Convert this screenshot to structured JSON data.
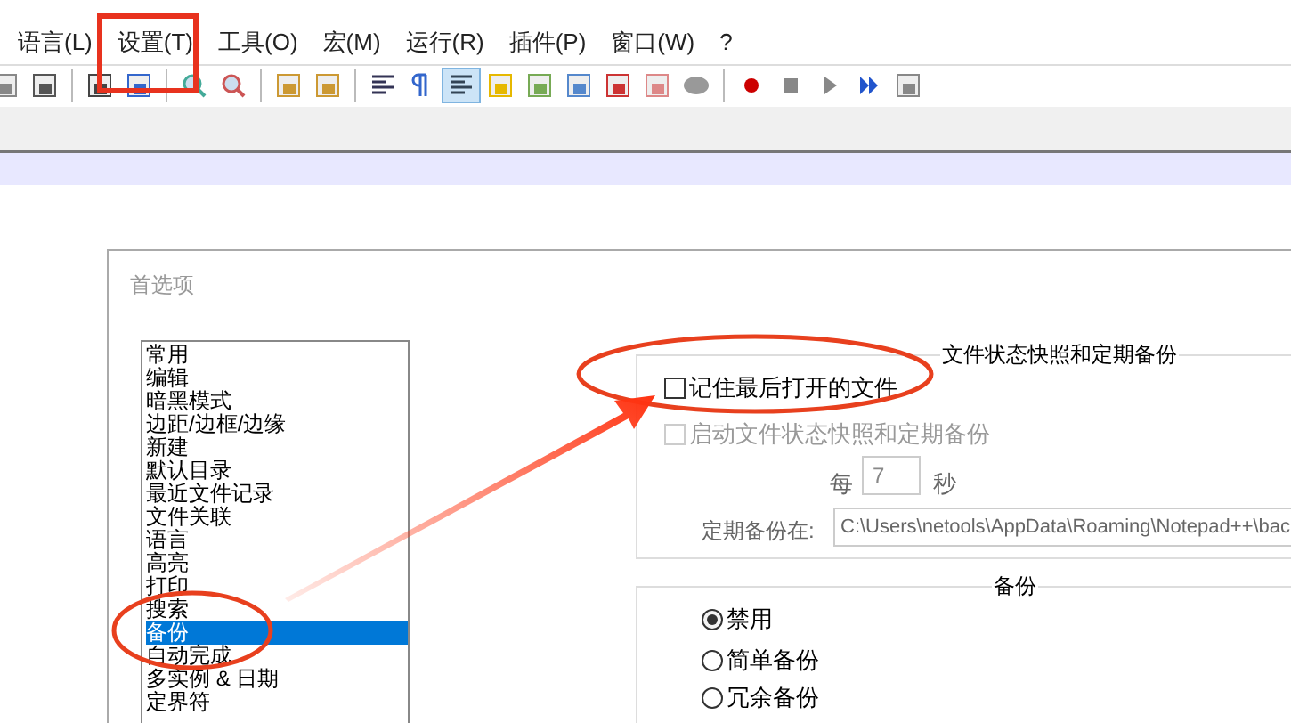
{
  "menu": [
    "语言(L)",
    "设置(T)",
    "工具(O)",
    "宏(M)",
    "运行(R)",
    "插件(P)",
    "窗口(W)",
    "?"
  ],
  "toolbar_buttons": [
    {
      "selected": false
    },
    {
      "selected": false
    },
    {
      "selected": false
    },
    {
      "selected": false
    },
    {
      "selected": false
    },
    {
      "selected": false
    },
    {
      "selected": false
    },
    {
      "selected": false
    },
    {
      "selected": false
    },
    {
      "selected": false
    },
    {
      "selected": true
    },
    {
      "selected": false
    },
    {
      "selected": false
    },
    {
      "selected": false
    },
    {
      "selected": false
    },
    {
      "selected": false
    },
    {
      "selected": false
    },
    {
      "selected": false
    },
    {
      "selected": false
    },
    {
      "selected": false
    },
    {
      "selected": false
    },
    {
      "selected": false
    }
  ],
  "dialog": {
    "title": "首选项",
    "categories": [
      {
        "label": "常用",
        "selected": false
      },
      {
        "label": "编辑",
        "selected": false
      },
      {
        "label": "暗黑模式",
        "selected": false
      },
      {
        "label": "边距/边框/边缘",
        "selected": false
      },
      {
        "label": "新建",
        "selected": false
      },
      {
        "label": "默认目录",
        "selected": false
      },
      {
        "label": "最近文件记录",
        "selected": false
      },
      {
        "label": "文件关联",
        "selected": false
      },
      {
        "label": "语言",
        "selected": false
      },
      {
        "label": "高亮",
        "selected": false
      },
      {
        "label": "打印",
        "selected": false
      },
      {
        "label": "搜索",
        "selected": false
      },
      {
        "label": "备份",
        "selected": true
      },
      {
        "label": "自动完成",
        "selected": false
      },
      {
        "label": "多实例 & 日期",
        "selected": false
      },
      {
        "label": "定界符",
        "selected": false
      }
    ],
    "snapshot_group": {
      "title": "文件状态快照和定期备份",
      "remember_last": {
        "label": "记住最后打开的文件",
        "checked": false,
        "disabled": false
      },
      "enable_snapshot": {
        "label": "启动文件状态快照和定期备份",
        "checked": false,
        "disabled": true
      },
      "every_label": "每",
      "every_value": "7",
      "seconds_label": "秒",
      "path_label": "定期备份在:",
      "path_value": "C:\\Users\\netools\\AppData\\Roaming\\Notepad++\\bac"
    },
    "backup_group": {
      "title": "备份",
      "options": [
        {
          "label": "禁用",
          "selected": true
        },
        {
          "label": "简单备份",
          "selected": false
        },
        {
          "label": "冗余备份",
          "selected": false
        }
      ]
    }
  }
}
